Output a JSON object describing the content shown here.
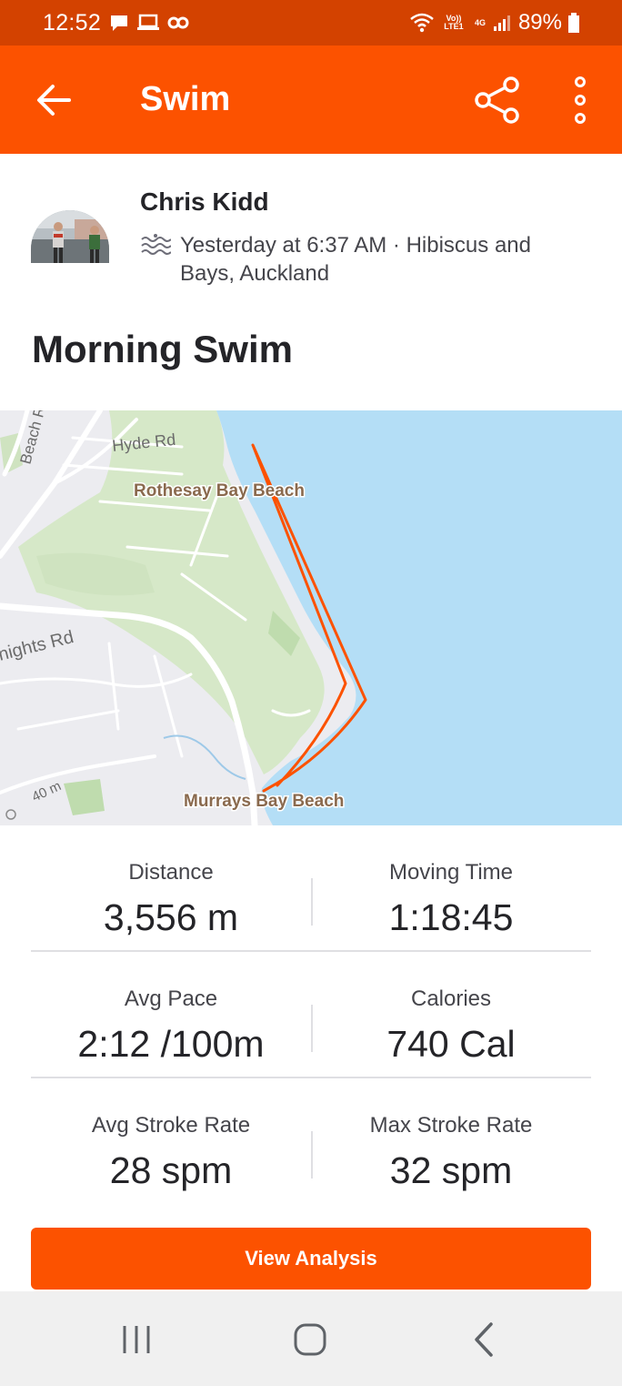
{
  "status_bar": {
    "time": "12:52",
    "battery": "89%",
    "net_top": "Vo)) LTE1",
    "net_4g": "4G",
    "icons": [
      "message-icon",
      "laptop-icon",
      "app-icon",
      "wifi-icon",
      "signal-icon",
      "battery-icon"
    ]
  },
  "app_bar": {
    "title": "Swim",
    "back_icon": "arrow-left-icon",
    "share_icon": "share-icon",
    "more_icon": "more-vertical-icon"
  },
  "athlete": {
    "name": "Chris Kidd",
    "meta": "Yesterday at 6:37 AM · Hibiscus and Bays, Auckland",
    "sport_icon": "swim-icon"
  },
  "activity": {
    "title": "Morning Swim"
  },
  "map": {
    "labels": {
      "beach_rd": "Beach R",
      "hyde_rd": "Hyde Rd",
      "rothesay": "Rothesay Bay Beach",
      "knights_rd": "nights Rd",
      "elevation": "40 m",
      "murrays": "Murrays Bay Beach"
    },
    "colors": {
      "water": "#b4def6",
      "land": "#ececf0",
      "park": "#d6e8c8",
      "route": "#fc5200"
    }
  },
  "stats": [
    {
      "left": {
        "label": "Distance",
        "value": "3,556 m"
      },
      "right": {
        "label": "Moving Time",
        "value": "1:18:45"
      }
    },
    {
      "left": {
        "label": "Avg Pace",
        "value": "2:12 /100m"
      },
      "right": {
        "label": "Calories",
        "value": "740 Cal"
      }
    },
    {
      "left": {
        "label": "Avg Stroke Rate",
        "value": "28 spm"
      },
      "right": {
        "label": "Max Stroke Rate",
        "value": "32 spm"
      }
    }
  ],
  "cta": {
    "label": "View Analysis"
  },
  "nav_bar": {
    "icons": [
      "recents-icon",
      "home-icon",
      "back-nav-icon"
    ]
  },
  "colors": {
    "brand": "#fc5200",
    "status_bar": "#d34200"
  }
}
